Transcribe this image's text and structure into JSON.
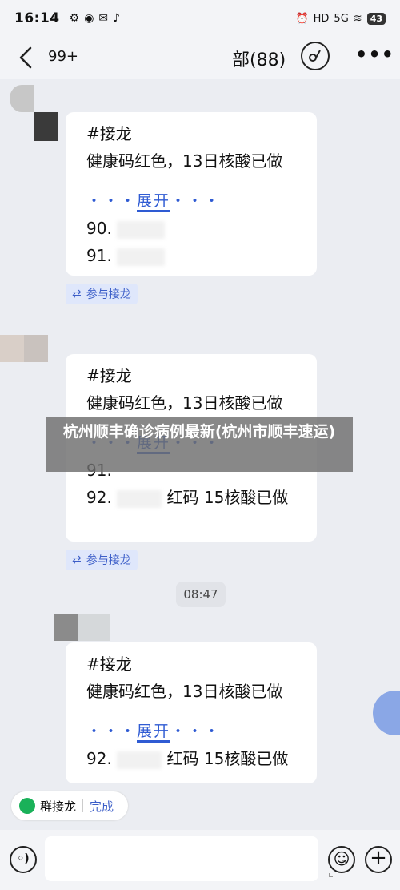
{
  "status_bar": {
    "time": "16:14",
    "left_icons": [
      "settings-icon",
      "alarm-icon",
      "mail-icon",
      "tiktok-icon"
    ],
    "right_icons": [
      "alarm-icon",
      "hd-icon",
      "signal-5g-icon",
      "wifi-icon"
    ],
    "network": "5G",
    "battery": "43"
  },
  "nav": {
    "unread_count": "99+",
    "title": "部(88)"
  },
  "messages": [
    {
      "hashtag": "#接龙",
      "line1": "健康码红色，13日核酸已做",
      "expand_dots_left": "・・・",
      "expand_label": "展开",
      "expand_dots_right": "・・・",
      "entries": [
        "90.",
        "91."
      ]
    },
    {
      "hashtag": "#接龙",
      "line1": "健康码红色，13日核酸已做",
      "expand_dots_left": "・・・",
      "expand_label": "展开",
      "expand_dots_right": "・・・",
      "entries": [
        "91.",
        "92."
      ],
      "entry2_suffix": "红码 15核酸已做"
    },
    {
      "hashtag": "#接龙",
      "line1": "健康码红色，13日核酸已做",
      "expand_dots_left": "・・・",
      "expand_label": "展开",
      "expand_dots_right": "・・・",
      "entries": [
        "92."
      ],
      "entry1_suffix": "红码 15核酸已做"
    }
  ],
  "join_label": "参与接龙",
  "time_divider": "08:47",
  "overlay_caption": "杭州顺丰确诊病例最新(杭州市顺丰速运)",
  "group_bar": {
    "label": "群接龙",
    "done": "完成"
  },
  "colors": {
    "accent": "#2f5bd3",
    "join_tag_bg": "#dfe7fb",
    "background": "#ebedf2"
  }
}
